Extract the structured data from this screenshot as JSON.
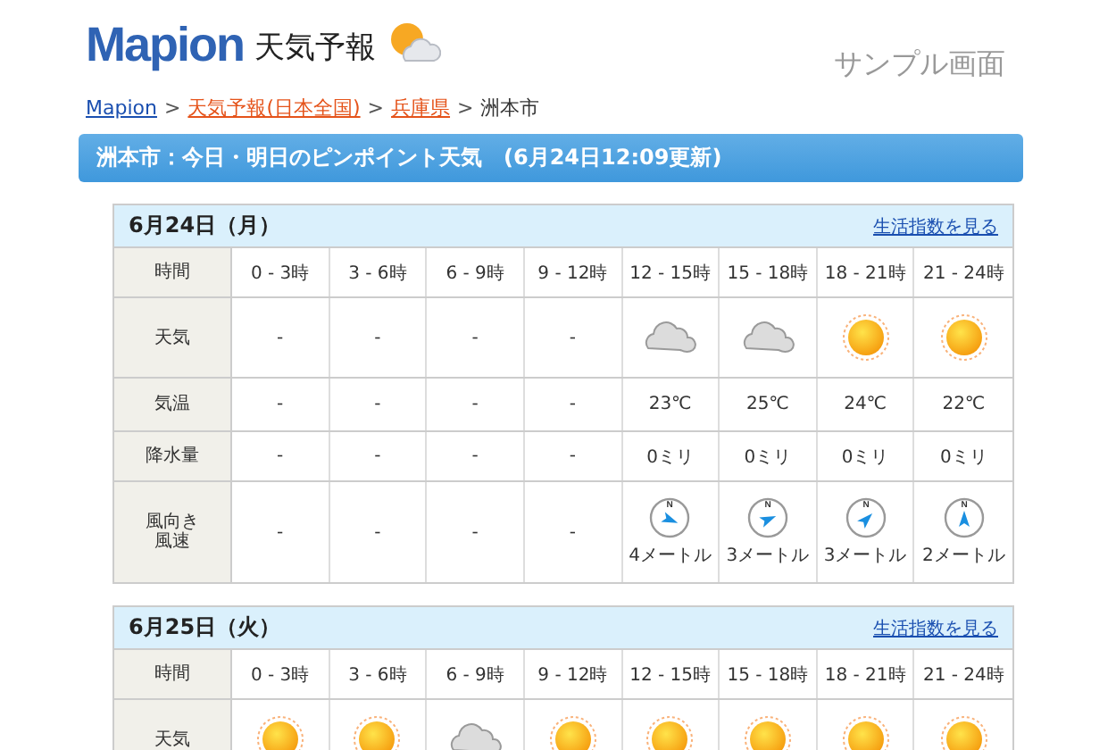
{
  "header": {
    "logo": "Mapion",
    "title": "天気予報",
    "sample_label": "サンプル画面"
  },
  "breadcrumb": {
    "separator": ">",
    "items": [
      {
        "label": "Mapion",
        "kind": "link"
      },
      {
        "label": "天気予報(日本全国)",
        "kind": "hot"
      },
      {
        "label": "兵庫県",
        "kind": "hot"
      },
      {
        "label": "洲本市",
        "kind": "current"
      }
    ]
  },
  "banner": "洲本市：今日・明日のピンポイント天気　(6月24日12:09更新)",
  "days": [
    {
      "date": "6月24日（月）",
      "link": "生活指数を見る",
      "rows": [
        {
          "kind": "time",
          "label": "時間",
          "cells": [
            {
              "kind": "text",
              "text": "0 - 3時"
            },
            {
              "kind": "text",
              "text": "3 - 6時"
            },
            {
              "kind": "text",
              "text": "6 - 9時"
            },
            {
              "kind": "text",
              "text": "9 - 12時"
            },
            {
              "kind": "text",
              "text": "12 - 15時"
            },
            {
              "kind": "text",
              "text": "15 - 18時"
            },
            {
              "kind": "text",
              "text": "18 - 21時"
            },
            {
              "kind": "text",
              "text": "21 - 24時"
            }
          ]
        },
        {
          "kind": "weather",
          "label": "天気",
          "cells": [
            {
              "kind": "text",
              "text": "-"
            },
            {
              "kind": "text",
              "text": "-"
            },
            {
              "kind": "text",
              "text": "-"
            },
            {
              "kind": "text",
              "text": "-"
            },
            {
              "kind": "cloudy"
            },
            {
              "kind": "cloudy"
            },
            {
              "kind": "sunny"
            },
            {
              "kind": "sunny"
            }
          ]
        },
        {
          "kind": "temp",
          "label": "気温",
          "cells": [
            {
              "kind": "text",
              "text": "-"
            },
            {
              "kind": "text",
              "text": "-"
            },
            {
              "kind": "text",
              "text": "-"
            },
            {
              "kind": "text",
              "text": "-"
            },
            {
              "kind": "text",
              "text": "23℃"
            },
            {
              "kind": "text",
              "text": "25℃"
            },
            {
              "kind": "text",
              "text": "24℃"
            },
            {
              "kind": "text",
              "text": "22℃"
            }
          ]
        },
        {
          "kind": "rain",
          "label": "降水量",
          "cells": [
            {
              "kind": "text",
              "text": "-"
            },
            {
              "kind": "text",
              "text": "-"
            },
            {
              "kind": "text",
              "text": "-"
            },
            {
              "kind": "text",
              "text": "-"
            },
            {
              "kind": "text",
              "text": "0ミリ"
            },
            {
              "kind": "text",
              "text": "0ミリ"
            },
            {
              "kind": "text",
              "text": "0ミリ"
            },
            {
              "kind": "text",
              "text": "0ミリ"
            }
          ]
        },
        {
          "kind": "wind",
          "label": "風向き風速",
          "cells": [
            {
              "kind": "text",
              "text": "-"
            },
            {
              "kind": "text",
              "text": "-"
            },
            {
              "kind": "text",
              "text": "-"
            },
            {
              "kind": "text",
              "text": "-"
            },
            {
              "kind": "wind_ese",
              "north_mark": "N",
              "text": "4メートル"
            },
            {
              "kind": "wind_ene",
              "north_mark": "N",
              "text": "3メートル"
            },
            {
              "kind": "wind_ne",
              "north_mark": "N",
              "text": "3メートル"
            },
            {
              "kind": "wind_n",
              "north_mark": "N",
              "text": "2メートル"
            }
          ]
        }
      ]
    },
    {
      "date": "6月25日（火）",
      "link": "生活指数を見る",
      "rows": [
        {
          "kind": "time",
          "label": "時間",
          "cells": [
            {
              "kind": "text",
              "text": "0 - 3時"
            },
            {
              "kind": "text",
              "text": "3 - 6時"
            },
            {
              "kind": "text",
              "text": "6 - 9時"
            },
            {
              "kind": "text",
              "text": "9 - 12時"
            },
            {
              "kind": "text",
              "text": "12 - 15時"
            },
            {
              "kind": "text",
              "text": "15 - 18時"
            },
            {
              "kind": "text",
              "text": "18 - 21時"
            },
            {
              "kind": "text",
              "text": "21 - 24時"
            }
          ]
        },
        {
          "kind": "weather",
          "label": "天気",
          "cells": [
            {
              "kind": "sunny"
            },
            {
              "kind": "sunny"
            },
            {
              "kind": "cloudy"
            },
            {
              "kind": "sunny"
            },
            {
              "kind": "sunny"
            },
            {
              "kind": "sunny"
            },
            {
              "kind": "sunny"
            },
            {
              "kind": "sunny"
            }
          ]
        }
      ]
    }
  ]
}
